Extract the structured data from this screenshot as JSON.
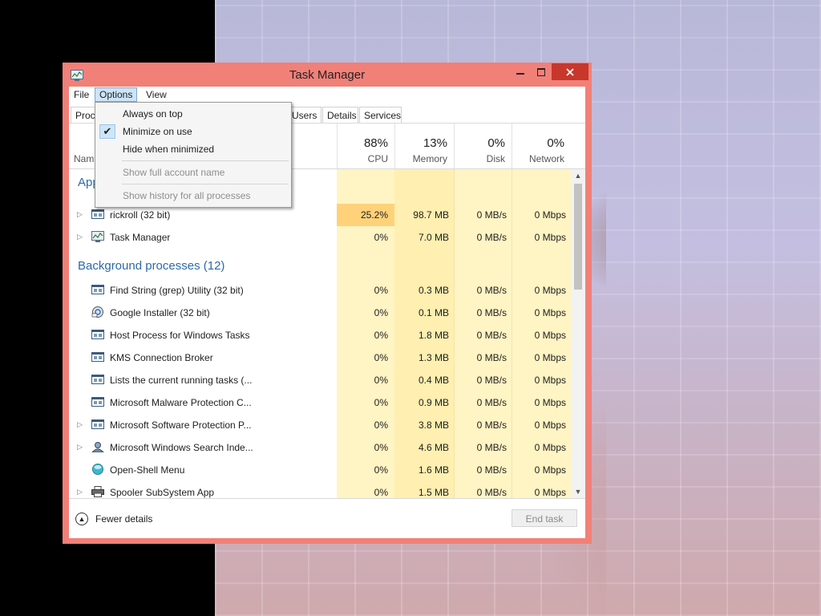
{
  "window": {
    "title": "Task Manager",
    "controls": {
      "minimize": "—",
      "maximize": "☐",
      "close": "✕"
    }
  },
  "menubar": {
    "file": "File",
    "options": "Options",
    "view": "View"
  },
  "tabs": {
    "processes": "Proc",
    "users": "Users",
    "details": "Details",
    "services": "Services"
  },
  "header": {
    "name": "Nam",
    "cpu": {
      "pct": "88%",
      "label": "CPU"
    },
    "memory": {
      "pct": "13%",
      "label": "Memory"
    },
    "disk": {
      "pct": "0%",
      "label": "Disk"
    },
    "network": {
      "pct": "0%",
      "label": "Network"
    }
  },
  "groups": {
    "apps": "App",
    "background": "Background processes (12)"
  },
  "apps": [
    {
      "name": "rickroll (32 bit)",
      "cpu": "25.2%",
      "memory": "98.7 MB",
      "disk": "0 MB/s",
      "network": "0 Mbps",
      "icon": "window-icon"
    },
    {
      "name": "Task Manager",
      "cpu": "0%",
      "memory": "7.0 MB",
      "disk": "0 MB/s",
      "network": "0 Mbps",
      "icon": "task-manager-icon"
    }
  ],
  "background": [
    {
      "name": "Find String (grep) Utility (32 bit)",
      "cpu": "0%",
      "memory": "0.3 MB",
      "disk": "0 MB/s",
      "network": "0 Mbps",
      "icon": "window-icon"
    },
    {
      "name": "Google Installer (32 bit)",
      "cpu": "0%",
      "memory": "0.1 MB",
      "disk": "0 MB/s",
      "network": "0 Mbps",
      "icon": "google-installer-icon"
    },
    {
      "name": "Host Process for Windows Tasks",
      "cpu": "0%",
      "memory": "1.8 MB",
      "disk": "0 MB/s",
      "network": "0 Mbps",
      "icon": "window-icon"
    },
    {
      "name": "KMS Connection Broker",
      "cpu": "0%",
      "memory": "1.3 MB",
      "disk": "0 MB/s",
      "network": "0 Mbps",
      "icon": "window-icon"
    },
    {
      "name": "Lists the current running tasks (...",
      "cpu": "0%",
      "memory": "0.4 MB",
      "disk": "0 MB/s",
      "network": "0 Mbps",
      "icon": "window-icon"
    },
    {
      "name": "Microsoft Malware Protection C...",
      "cpu": "0%",
      "memory": "0.9 MB",
      "disk": "0 MB/s",
      "network": "0 Mbps",
      "icon": "window-icon"
    },
    {
      "name": "Microsoft Software Protection P...",
      "cpu": "0%",
      "memory": "3.8 MB",
      "disk": "0 MB/s",
      "network": "0 Mbps",
      "icon": "window-icon"
    },
    {
      "name": "Microsoft Windows Search Inde...",
      "cpu": "0%",
      "memory": "4.6 MB",
      "disk": "0 MB/s",
      "network": "0 Mbps",
      "icon": "search-indexer-icon"
    },
    {
      "name": "Open-Shell Menu",
      "cpu": "0%",
      "memory": "1.6 MB",
      "disk": "0 MB/s",
      "network": "0 Mbps",
      "icon": "shell-icon"
    },
    {
      "name": "Spooler SubSystem App",
      "cpu": "0%",
      "memory": "1.5 MB",
      "disk": "0 MB/s",
      "network": "0 Mbps",
      "icon": "printer-icon"
    }
  ],
  "options_menu": {
    "always_on_top": "Always on top",
    "minimize_on_use": "Minimize on use",
    "hide_when_minimized": "Hide when minimized",
    "show_full_account_name": "Show full account name",
    "show_history": "Show history for all processes"
  },
  "footer": {
    "fewer_details": "Fewer details",
    "end_task": "End task"
  },
  "colors": {
    "window_frame": "#f18078",
    "close_button": "#c7372b",
    "cpu_hot": "#ffd27a",
    "heat_light": "#fff4c4",
    "group_text": "#2c6aa8"
  }
}
